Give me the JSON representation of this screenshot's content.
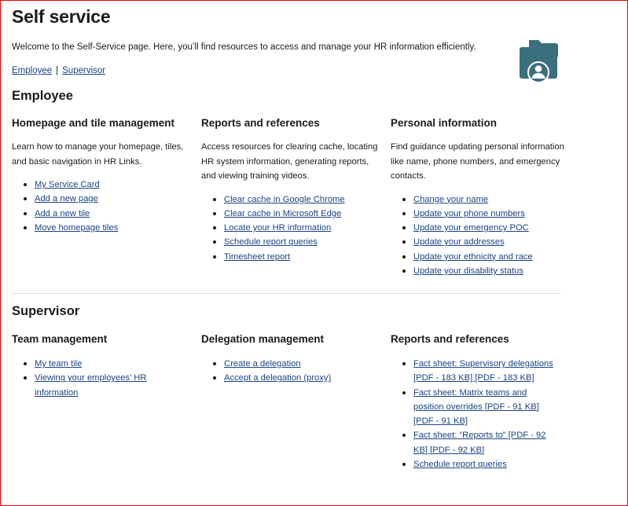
{
  "page": {
    "title": "Self service",
    "intro": "Welcome to the Self-Service page. Here, you’ll find resources to access and manage your HR information efficiently.",
    "anchors": {
      "employee": "Employee",
      "separator": "|",
      "supervisor": "Supervisor"
    },
    "accent_color": "#3a6f7e",
    "link_color": "#1a4480",
    "icon": "folder-user-icon"
  },
  "employee": {
    "heading": "Employee",
    "columns": [
      {
        "title": "Homepage and tile management",
        "description": "Learn how to manage your homepage, tiles, and basic navigation in HR Links.",
        "links": [
          "My Service Card",
          "Add a new page",
          "Add a new tile",
          "Move homepage tiles"
        ]
      },
      {
        "title": "Reports and references",
        "description": "Access resources for clearing cache, locating HR system information, generating reports, and viewing training videos.",
        "links": [
          "Clear cache in Google Chrome",
          "Clear cache in Microsoft Edge",
          "Locate your HR information",
          "Schedule report queries",
          "Timesheet report"
        ]
      },
      {
        "title": "Personal information",
        "description": "Find guidance updating personal information like name, phone numbers, and emergency contacts.",
        "links": [
          "Change your name",
          "Update your phone numbers",
          "Update your emergency POC",
          "Update your addresses",
          "Update your ethnicity and race",
          "Update your disability status"
        ]
      }
    ]
  },
  "supervisor": {
    "heading": "Supervisor",
    "columns": [
      {
        "title": "Team management",
        "links": [
          "My team tile",
          "Viewing your employees’ HR information"
        ]
      },
      {
        "title": "Delegation management",
        "links": [
          "Create a delegation",
          "Accept a delegation (proxy)"
        ]
      },
      {
        "title": "Reports and references",
        "links": [
          "Fact sheet: Supervisory delegations [PDF - 183 KB] [PDF - 183 KB]",
          "Fact sheet: Matrix teams and position overrides [PDF - 91 KB] [PDF - 91 KB]",
          "Fact sheet: “Reports to” [PDF - 92 KB] [PDF - 92 KB]",
          "Schedule report queries"
        ]
      }
    ]
  }
}
